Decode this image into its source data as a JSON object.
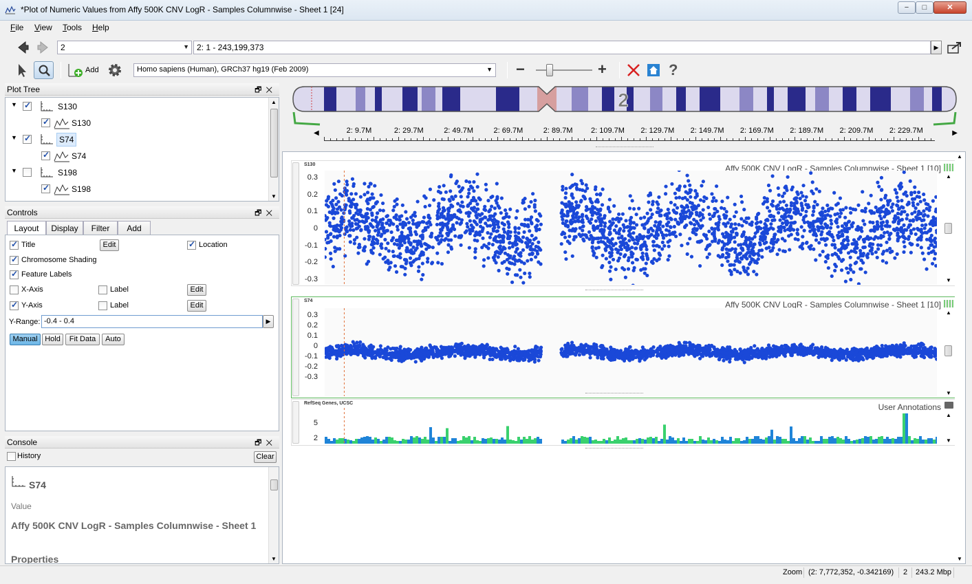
{
  "window": {
    "title": "*Plot of Numeric Values from Affy 500K CNV LogR - Samples Columnwise - Sheet 1 [24]",
    "controls": [
      "−",
      "□",
      "✕"
    ]
  },
  "menu": [
    {
      "label": "File",
      "key": "F"
    },
    {
      "label": "View",
      "key": "V"
    },
    {
      "label": "Tools",
      "key": "T"
    },
    {
      "label": "Help",
      "key": "H"
    }
  ],
  "nav": {
    "chromosome": "2",
    "location": "2: 1 - 243,199,373"
  },
  "toolbar": {
    "add_label": "Add",
    "genome": "Homo sapiens (Human), GRCh37 hg19 (Feb 2009)",
    "zoom_level": 0.21
  },
  "plot_tree": {
    "title": "Plot Tree",
    "items": [
      {
        "label": "S130",
        "child": "S130",
        "checked": true
      },
      {
        "label": "S74",
        "child": "S74",
        "checked": true
      },
      {
        "label": "S198",
        "child": "S198",
        "checked": false
      }
    ]
  },
  "controls_panel": {
    "title": "Controls",
    "tabs": [
      "Layout",
      "Display",
      "Filter",
      "Add"
    ],
    "title_cb": "Title",
    "edit": "Edit",
    "location_cb": "Location",
    "chrom_shading": "Chromosome Shading",
    "feature_labels": "Feature Labels",
    "x_axis": "X-Axis",
    "y_axis": "Y-Axis",
    "label": "Label",
    "y_range_label": "Y-Range:",
    "y_range_value": "-0.4 - 0.4",
    "mode_buttons": [
      "Manual",
      "Hold",
      "Fit Data",
      "Auto"
    ]
  },
  "console": {
    "title": "Console",
    "history": "History",
    "clear": "Clear",
    "item": "S74",
    "value_label": "Value",
    "value": "Affy 500K CNV LogR - Samples Columnwise - Sheet 1",
    "properties": "Properties"
  },
  "ideogram": {
    "chromosome_label": "2"
  },
  "ruler": {
    "ticks": [
      "2: 9.7M",
      "2: 29.7M",
      "2: 49.7M",
      "2: 69.7M",
      "2: 89.7M",
      "2: 109.7M",
      "2: 129.7M",
      "2: 149.7M",
      "2: 169.7M",
      "2: 189.7M",
      "2: 209.7M",
      "2: 229.7M"
    ]
  },
  "tracks": [
    {
      "name": "S130",
      "title": "Affy 500K CNV LogR - Samples Columnwise - Sheet 1 [10]",
      "yticks": [
        "0.3",
        "0.2",
        "0.1",
        "0",
        "-0.1",
        "-0.2",
        "-0.3"
      ]
    },
    {
      "name": "S74",
      "title": "Affy 500K CNV LogR - Samples Columnwise - Sheet 1 [10]",
      "yticks": [
        "0.3",
        "0.2",
        "0.1",
        "0",
        "-0.1",
        "-0.2",
        "-0.3"
      ]
    },
    {
      "name": "RefSeq Genes, UCSC",
      "title": "User Annotations",
      "yticks": [
        "5",
        "2"
      ]
    }
  ],
  "chart_data": {
    "type": "scatter",
    "y_range": [
      -0.4,
      0.4
    ],
    "x_range_mbp": [
      0,
      243.2
    ],
    "series": [
      {
        "name": "S130",
        "spread": 0.28,
        "gap_mbp": [
          86,
          94
        ]
      },
      {
        "name": "S74",
        "spread": 0.06,
        "gap_mbp": [
          86,
          94
        ]
      }
    ],
    "marker_mbp": 7.77,
    "point_color": "#1a48d8"
  },
  "status": {
    "mode": "Zoom",
    "coords": "(2: 7,772,352, -0.342169)",
    "chrom": "2",
    "size": "243.2 Mbp"
  },
  "colors": {
    "chrom_band": "#2a2a8a",
    "chrom_light": "#8c87c5",
    "centromere": "#d9a0a0",
    "density_blue": "#1f84d8",
    "density_green": "#3ad16e"
  }
}
